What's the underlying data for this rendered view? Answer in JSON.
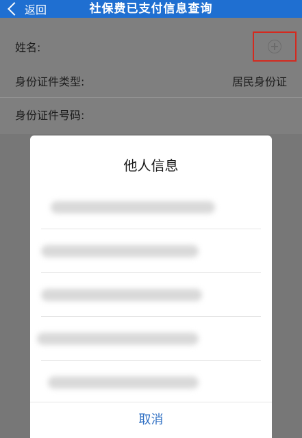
{
  "header": {
    "back_label": "返回",
    "title": "社保费已支付信息查询"
  },
  "form": {
    "name_label": "姓名:",
    "id_type_label": "身份证件类型:",
    "id_type_value": "居民身份证",
    "id_number_label": "身份证件号码:"
  },
  "modal": {
    "title": "他人信息",
    "entries": [
      "",
      "",
      "",
      "",
      ""
    ],
    "cancel_label": "取消"
  },
  "colors": {
    "nav": "#1f6fd1",
    "highlight": "#d42a1f",
    "link": "#2f6fc3"
  }
}
